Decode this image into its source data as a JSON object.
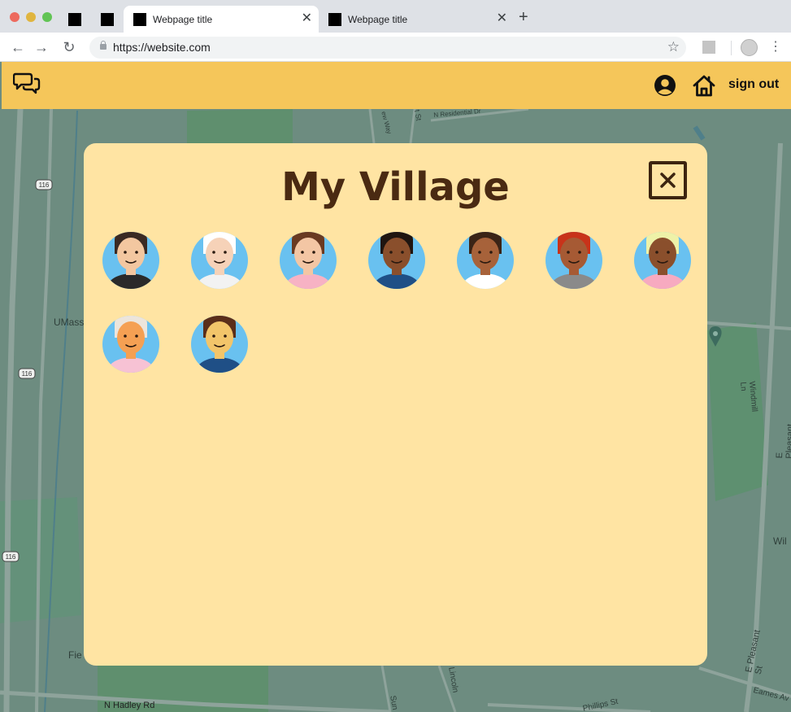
{
  "browser": {
    "tabs": [
      {
        "title": "Webpage title",
        "active": true
      },
      {
        "title": "Webpage title",
        "active": false
      }
    ],
    "url": "https://website.com"
  },
  "header": {
    "logo_icon": "chat-bubbles-icon",
    "account_icon": "user-circle-icon",
    "home_icon": "home-icon",
    "sign_out_label": "sign out",
    "background": "#f5c65a"
  },
  "map": {
    "labels": [
      "UMass",
      "N Residential Dr",
      "N Hadley Rd",
      "Windmill Ln",
      "E Pleasant St",
      "E Pleasant St",
      "Eames Av",
      "Phillips St",
      "Lincoln",
      "Sun",
      "Fie",
      "Wil",
      "ew Way",
      "t St",
      "116",
      "116",
      "116"
    ]
  },
  "modal": {
    "title": "My Village",
    "close_icon": "close-x-icon",
    "background": "#ffe4a3",
    "members": [
      {
        "name": "member-1",
        "skin": "#f3c7a0",
        "hair": "#3b2a23",
        "shirt": "#2a2a2a"
      },
      {
        "name": "member-2",
        "skin": "#f6d2b8",
        "hair": "#ffffff",
        "shirt": "#f2f2f2"
      },
      {
        "name": "member-3",
        "skin": "#f3c6a4",
        "hair": "#6a3a22",
        "shirt": "#f7b2c4"
      },
      {
        "name": "member-4",
        "skin": "#8a4f2c",
        "hair": "#1f1510",
        "shirt": "#1f4f86"
      },
      {
        "name": "member-5",
        "skin": "#a7623a",
        "hair": "#3b2416",
        "shirt": "#ffffff"
      },
      {
        "name": "member-6",
        "skin": "#a65a34",
        "hair": "#c8331a",
        "shirt": "#8a8a8a"
      },
      {
        "name": "member-7",
        "skin": "#8a4f2c",
        "hair": "#eef2a8",
        "shirt": "#f7aac0"
      },
      {
        "name": "member-8",
        "skin": "#f5a053",
        "hair": "#ece5dc",
        "shirt": "#f7c2d4"
      },
      {
        "name": "member-9",
        "skin": "#f2c56a",
        "hair": "#5a2e1a",
        "shirt": "#1f4f86"
      }
    ]
  }
}
